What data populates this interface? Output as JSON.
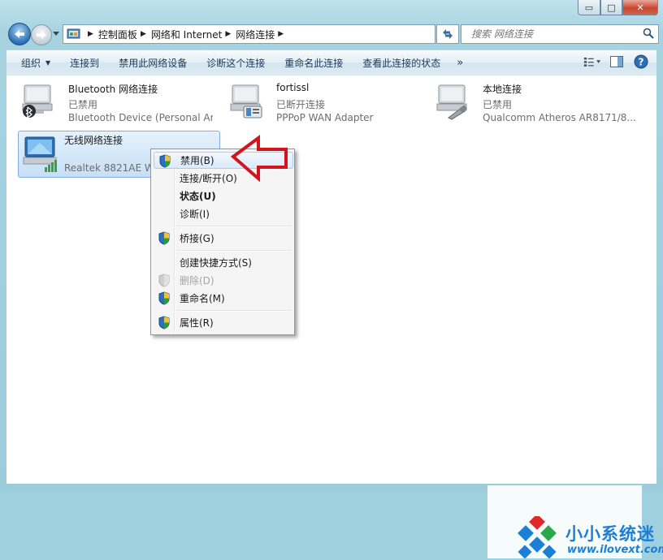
{
  "window": {
    "caption": {
      "minimize": "▭",
      "maximize": "□",
      "close": "✕"
    }
  },
  "address_bar": {
    "crumbs": [
      "控制面板",
      "网络和 Internet",
      "网络连接"
    ]
  },
  "search": {
    "placeholder": "搜索 网络连接"
  },
  "toolbar": {
    "items": [
      "组织",
      "连接到",
      "禁用此网络设备",
      "诊断这个连接",
      "重命名此连接",
      "查看此连接的状态"
    ],
    "more": "»"
  },
  "connections": [
    {
      "name": "Bluetooth 网络连接",
      "status": "已禁用",
      "device": "Bluetooth Device (Personal Ar...",
      "icon": "bluetooth-network-icon"
    },
    {
      "name": "fortissl",
      "status": "已断开连接",
      "device": "PPPoP WAN Adapter",
      "icon": "vpn-modem-icon"
    },
    {
      "name": "本地连接",
      "status": "已禁用",
      "device": "Qualcomm Atheros AR8171/8...",
      "icon": "ethernet-network-icon"
    },
    {
      "name": "无线网络连接",
      "status": "",
      "device": "Realtek 8821AE W",
      "icon": "wireless-network-icon"
    }
  ],
  "context_menu": {
    "items": [
      {
        "label": "禁用(B)",
        "shield": true,
        "state": "highlighted"
      },
      {
        "label": "连接/断开(O)",
        "shield": false,
        "state": "normal"
      },
      {
        "label": "状态(U)",
        "shield": false,
        "state": "default"
      },
      {
        "label": "诊断(I)",
        "shield": false,
        "state": "normal"
      },
      {
        "label": "桥接(G)",
        "shield": true,
        "state": "normal"
      },
      {
        "label": "创建快捷方式(S)",
        "shield": false,
        "state": "normal"
      },
      {
        "label": "删除(D)",
        "shield": true,
        "state": "disabled"
      },
      {
        "label": "重命名(M)",
        "shield": true,
        "state": "normal"
      },
      {
        "label": "属性(R)",
        "shield": true,
        "state": "normal"
      }
    ]
  },
  "watermark": {
    "title": "小小系统迷",
    "url": "www.ilovext.com"
  },
  "colors": {
    "accent": "#1b7fd6",
    "arrow": "#d0161c",
    "selection": "#c6e0f6"
  }
}
